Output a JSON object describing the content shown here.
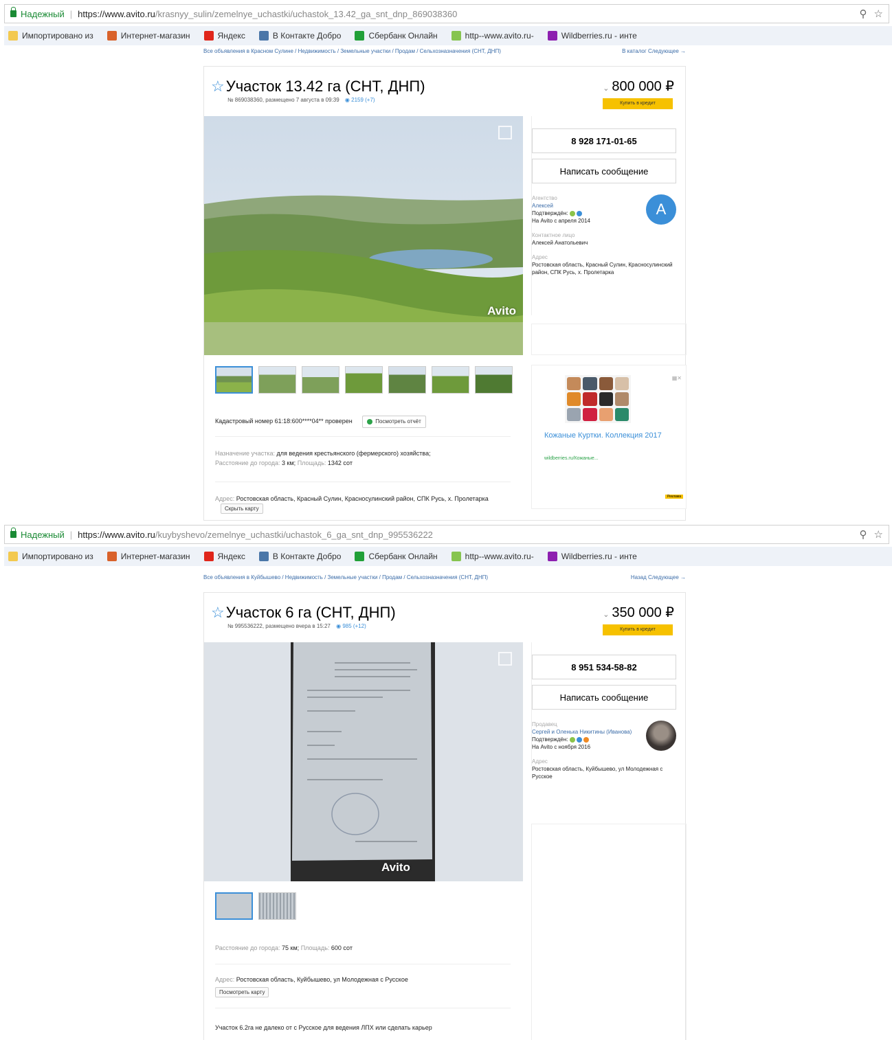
{
  "browser": {
    "secure_label": "Надежный",
    "bookmarks": [
      {
        "label": "Импортировано из",
        "icon": "folder-icon",
        "color": "#f3c94f"
      },
      {
        "label": "Интернет-магазин",
        "icon": "shop-icon",
        "color": "#d9622b"
      },
      {
        "label": "Яндекс",
        "icon": "yandex-icon",
        "color": "#e0261b"
      },
      {
        "label": "В Контакте  Добро",
        "icon": "vk-icon",
        "color": "#4a76a8"
      },
      {
        "label": "Сбербанк Онлайн",
        "icon": "sberbank-icon",
        "color": "#21a038"
      },
      {
        "label": "http--www.avito.ru-",
        "icon": "avito-icon",
        "color": "#86c44f"
      },
      {
        "label": "Wildberries.ru - инте",
        "icon": "wildberries-icon",
        "color": "#8d1fb0"
      }
    ]
  },
  "listings": [
    {
      "url_base": "https://www.avito.ru",
      "url_path": "/krasnyy_sulin/zemelnye_uchastki/uchastok_13.42_ga_snt_dnp_869038360",
      "breadcrumbs": "Все объявления в Красном Сулине / Недвижимость / Земельные участки / Продам / Сельхозназначения (СНТ, ДНП)",
      "nav": "В каталог  Следующее →",
      "title": "Участок 13.42 га (СНТ, ДНП)",
      "meta": "№ 869038360, размещено 7 августа в 09:39",
      "views": "2159 (+7)",
      "price": "800 000 ₽",
      "credit_label": "Купить в кредит",
      "watermark": "Avito",
      "thumb_count": 7,
      "cadastral": "Кадастровый номер 61:18:600****04** проверен",
      "report_label": "Посмотреть отчёт",
      "purpose_label": "Назначение участка:",
      "purpose": "для ведения крестьянского (фермерского) хозяйства;",
      "distance_label": "Расстояние до города:",
      "distance": "3 км;",
      "area_label": "Площадь:",
      "area": "1342 сот",
      "address_label": "Адрес:",
      "address": "Ростовская область, Красный Сулин, Красносулинский район, СПК Русь, х. Пролетарка",
      "map_label": "Скрыть карту",
      "phone": "8 928 171-01-65",
      "message_label": "Написать сообщение",
      "seller_role": "Агентство",
      "seller_name": "Алексей",
      "verified": "Подтверждён:",
      "since": "На Avito с апреля 2014",
      "avatar_letter": "A",
      "contact_label": "Контактное лицо",
      "contact": "Алексей Анатольевич",
      "side_address_label": "Адрес",
      "side_address": "Ростовская область, Красный Сулин, Красносулинский район, СПК Русь, х. Пролетарка",
      "ad_title": "Кожаные Куртки. Коллекция 2017",
      "ad_domain": "wildberries.ru/Кожаные...",
      "ad_tag": "Реклама"
    },
    {
      "url_base": "https://www.avito.ru",
      "url_path": "/kuybyshevo/zemelnye_uchastki/uchastok_6_ga_snt_dnp_995536222",
      "breadcrumbs": "Все объявления в Куйбышево / Недвижимость / Земельные участки / Продам / Сельхозназначения (СНТ, ДНП)",
      "nav": "Назад  Следующее →",
      "title": "Участок 6 га (СНТ, ДНП)",
      "meta": "№ 995536222, размещено вчера в 15:27",
      "views": "985 (+12)",
      "price": "350 000 ₽",
      "credit_label": "Купить в кредит",
      "watermark": "Avito",
      "thumb_count": 2,
      "distance_label": "Расстояние до города:",
      "distance": "75 км;",
      "area_label": "Площадь:",
      "area": "600 сот",
      "address_label": "Адрес:",
      "address": "Ростовская область, Куйбышево, ул Молодежная с Русское",
      "map_label": "Посмотреть карту",
      "description": "Участок 6.2га не далеко от с Русское для ведения ЛПХ или сделать карьер",
      "phone": "8 951 534-58-82",
      "message_label": "Написать сообщение",
      "seller_role": "Продавец",
      "seller_name": "Сергей и Оленька Никитины (Иванова)",
      "verified": "Подтверждён:",
      "since": "На Avito с ноября 2016",
      "side_address_label": "Адрес",
      "side_address": "Ростовская область, Куйбышево, ул Молодежная с Русское"
    }
  ]
}
